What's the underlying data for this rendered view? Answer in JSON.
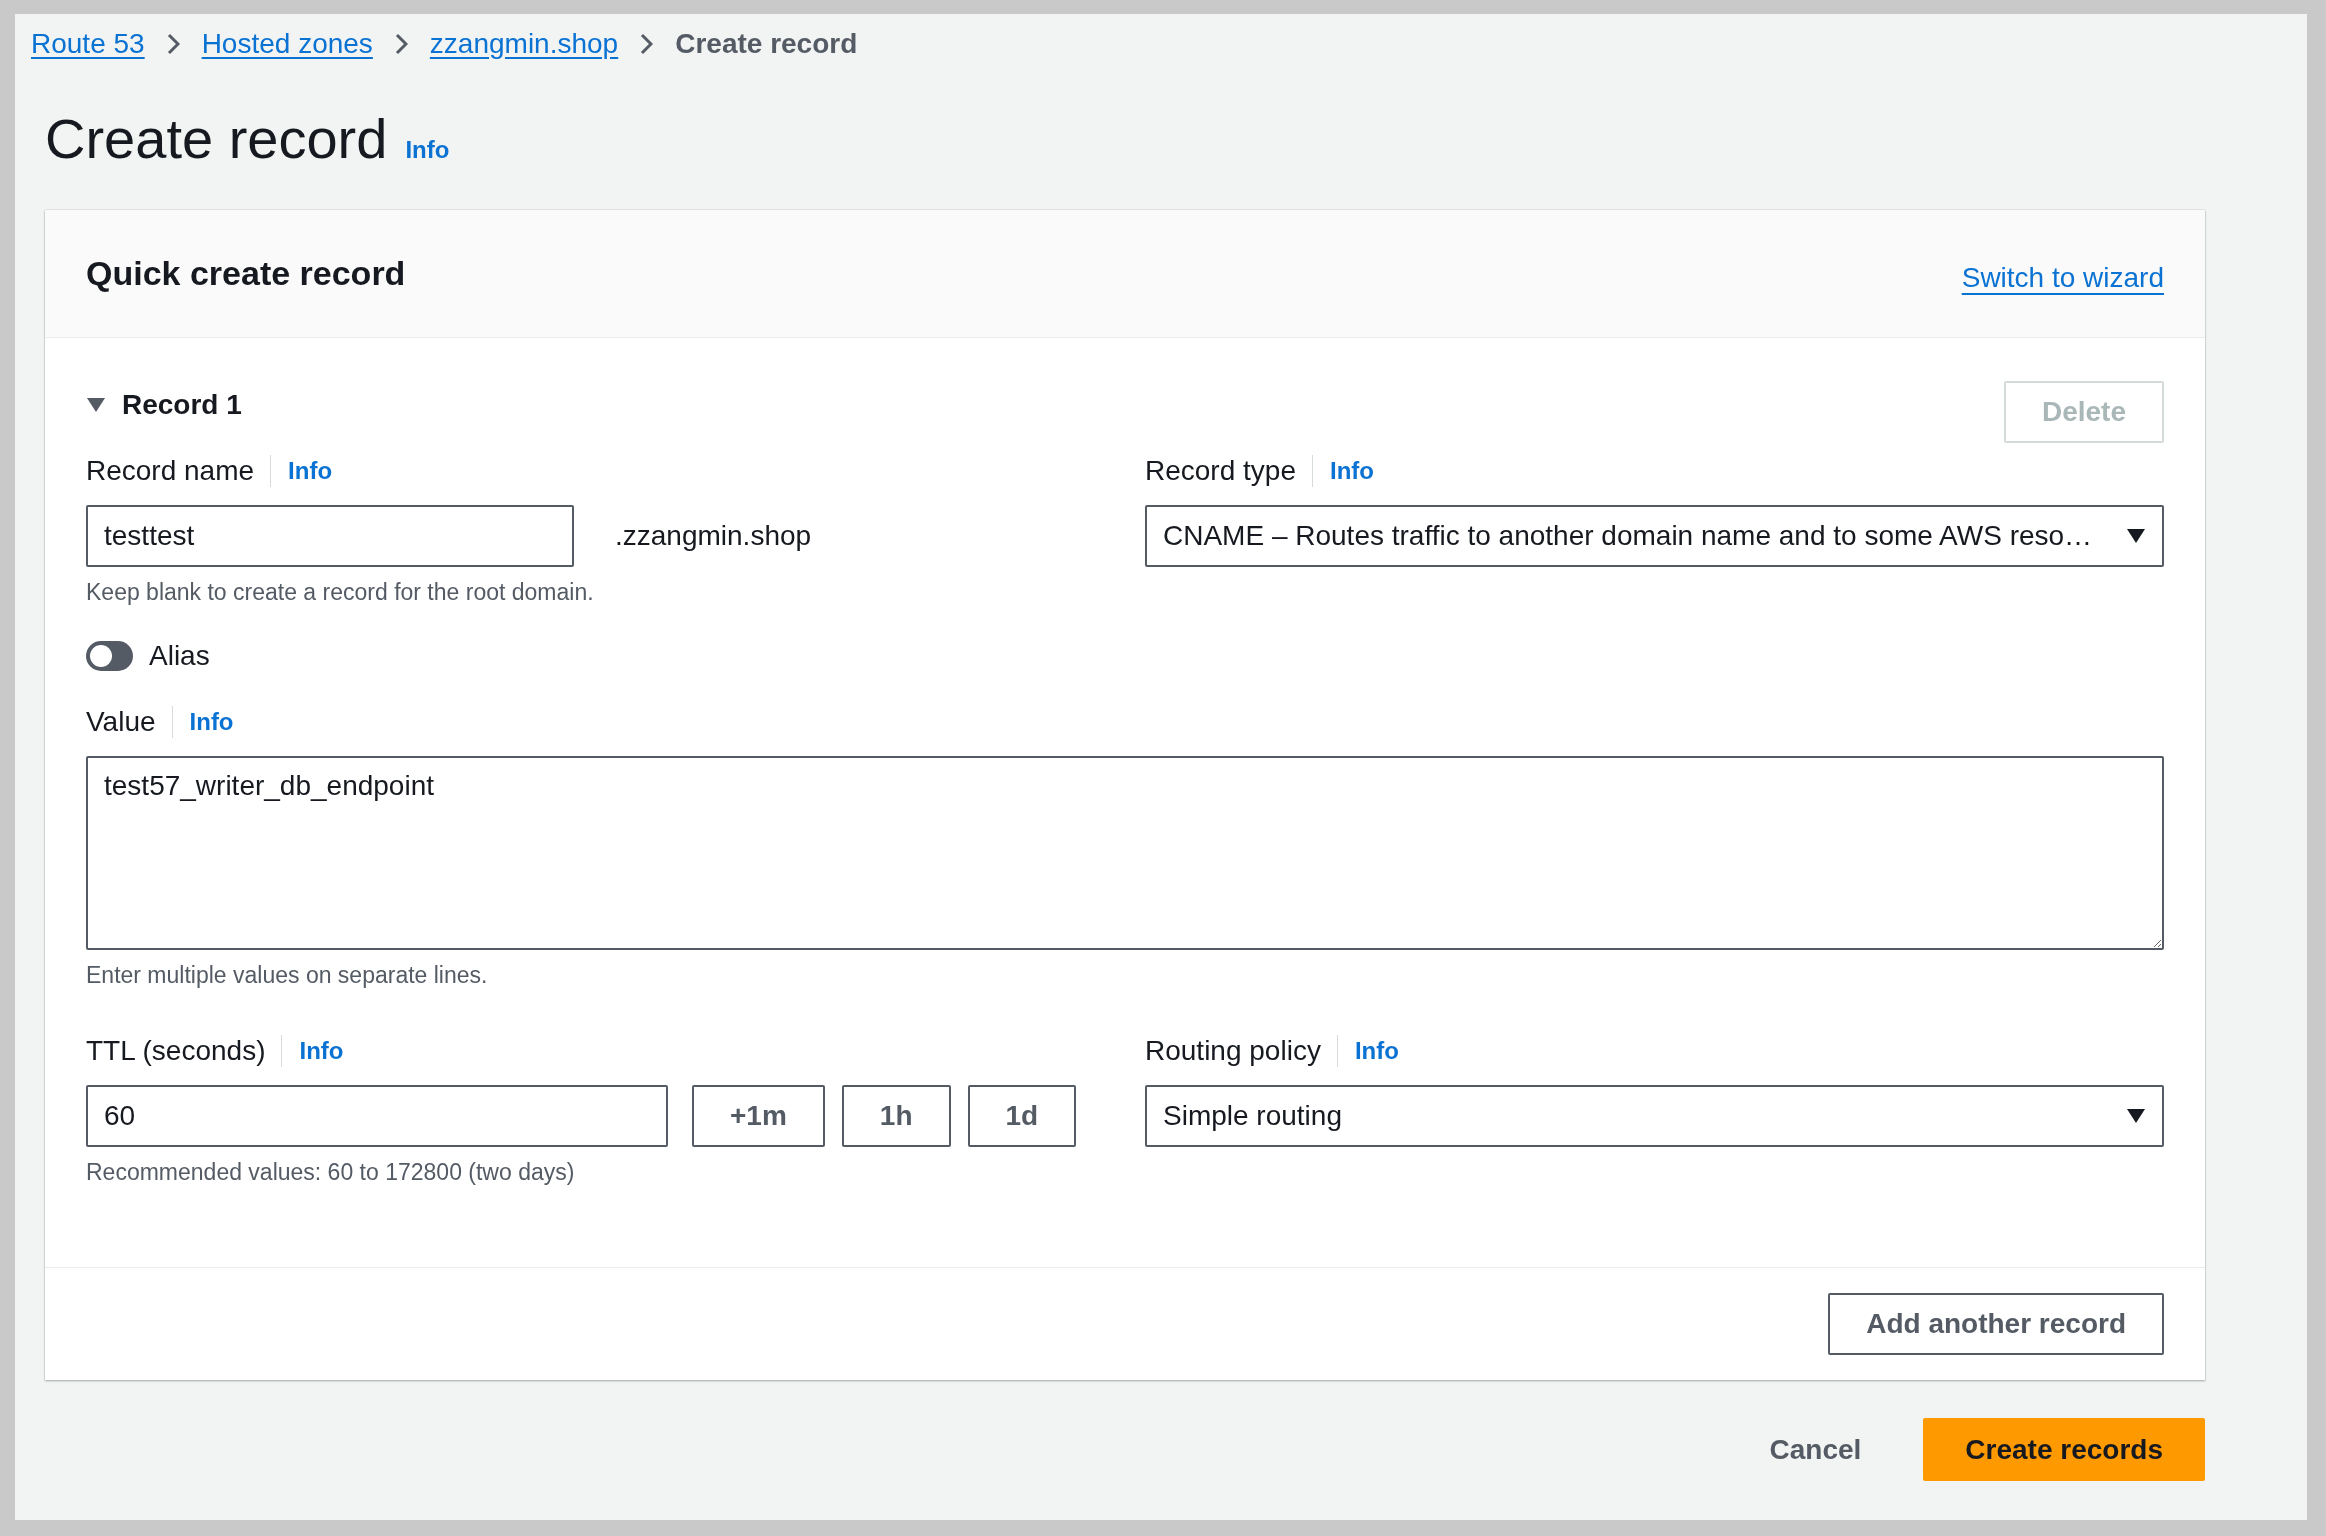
{
  "breadcrumbs": [
    {
      "label": "Route 53",
      "current": false
    },
    {
      "label": "Hosted zones",
      "current": false
    },
    {
      "label": "zzangmin.shop",
      "current": false
    },
    {
      "label": "Create record",
      "current": true
    }
  ],
  "page": {
    "title": "Create record",
    "info": "Info"
  },
  "card": {
    "title": "Quick create record",
    "switch_link": "Switch to wizard",
    "record": {
      "title": "Record 1",
      "expanded": true,
      "delete": {
        "label": "Delete",
        "disabled": true
      },
      "record_name": {
        "label": "Record name",
        "info": "Info",
        "value": "testtest",
        "suffix": ".zzangmin.shop",
        "hint": "Keep blank to create a record for the root domain."
      },
      "record_type": {
        "label": "Record type",
        "info": "Info",
        "value": "CNAME – Routes traffic to another domain name and to some AWS reso…"
      },
      "alias": {
        "label": "Alias",
        "on": false
      },
      "value": {
        "label": "Value",
        "info": "Info",
        "value": "test57_writer_db_endpoint",
        "hint": "Enter multiple values on separate lines."
      },
      "ttl": {
        "label": "TTL (seconds)",
        "info": "Info",
        "value": "60",
        "buttons": [
          "+1m",
          "1h",
          "1d"
        ],
        "hint": "Recommended values: 60 to 172800 (two days)"
      },
      "routing_policy": {
        "label": "Routing policy",
        "info": "Info",
        "value": "Simple routing"
      }
    },
    "add_button": "Add another record"
  },
  "actions": {
    "cancel": "Cancel",
    "submit": "Create records"
  }
}
